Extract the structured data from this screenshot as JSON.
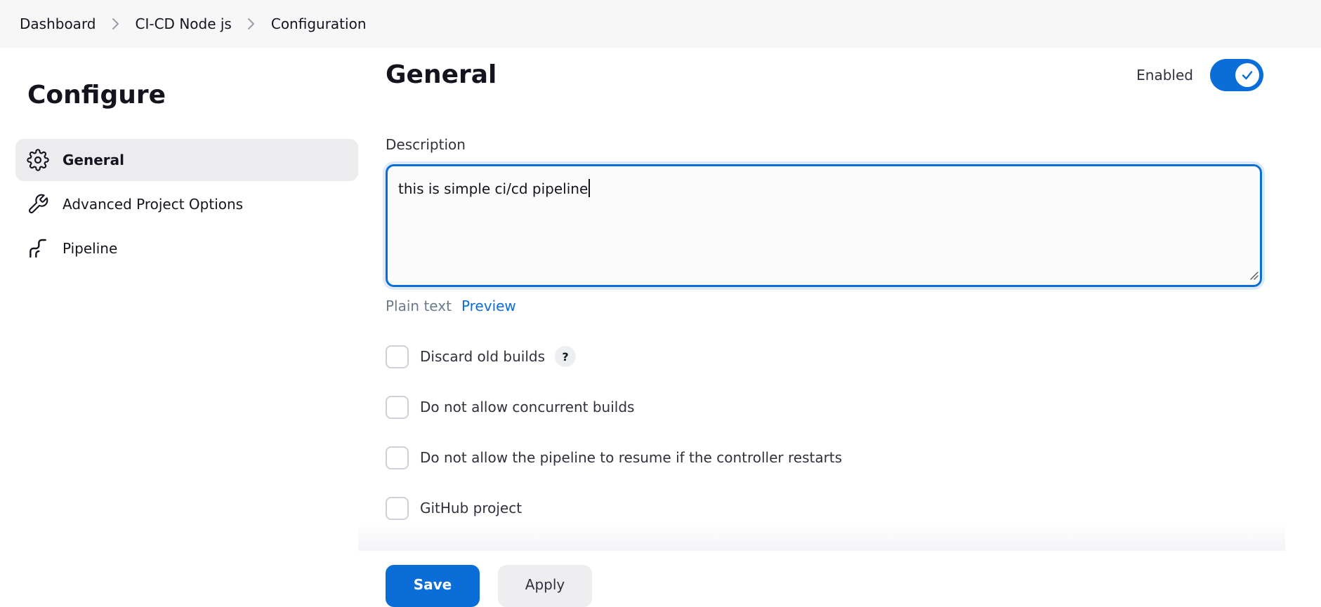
{
  "breadcrumb": {
    "items": [
      "Dashboard",
      "CI-CD Node js",
      "Configuration"
    ]
  },
  "sidebar": {
    "title": "Configure",
    "items": [
      {
        "label": "General",
        "icon": "gear-icon",
        "active": true
      },
      {
        "label": "Advanced Project Options",
        "icon": "wrench-icon",
        "active": false
      },
      {
        "label": "Pipeline",
        "icon": "pipeline-icon",
        "active": false
      }
    ]
  },
  "main": {
    "section_title": "General",
    "enabled_label": "Enabled",
    "enabled": true,
    "description_label": "Description",
    "description_value": "this is simple ci/cd pipeline",
    "format_plain": "Plain text",
    "format_preview": "Preview",
    "options": [
      {
        "label": "Discard old builds",
        "checked": false,
        "help": "?"
      },
      {
        "label": "Do not allow concurrent builds",
        "checked": false
      },
      {
        "label": "Do not allow the pipeline to resume if the controller restarts",
        "checked": false
      },
      {
        "label": "GitHub project",
        "checked": false
      }
    ]
  },
  "footer": {
    "save_label": "Save",
    "apply_label": "Apply"
  },
  "colors": {
    "accent": "#0b6dd7",
    "active_bg": "#ececef",
    "topbar_bg": "#f7f7f8"
  }
}
